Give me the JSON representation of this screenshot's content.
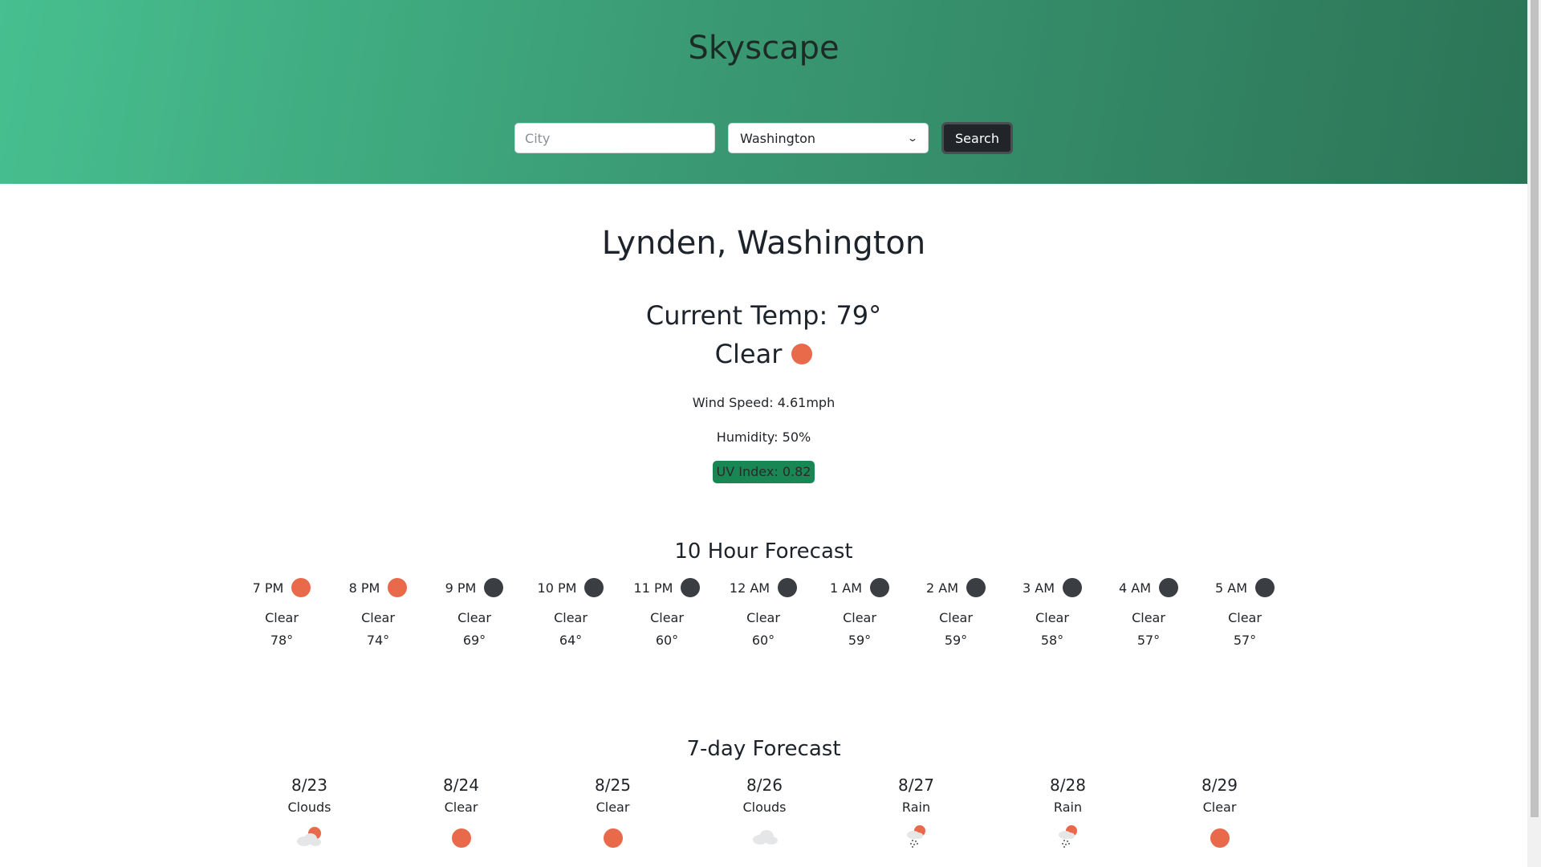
{
  "app": {
    "title": "Skyscape"
  },
  "search": {
    "city_placeholder": "City",
    "city_value": "",
    "state_selected": "Washington",
    "button_label": "Search"
  },
  "current": {
    "location": "Lynden, Washington",
    "temp": "Current Temp: 79°",
    "condition": "Clear",
    "condition_icon": "sun-icon",
    "wind": "Wind Speed: 4.61mph",
    "humidity": "Humidity: 50%",
    "uv": "UV Index: 0.82"
  },
  "hourly": {
    "title": "10 Hour Forecast",
    "items": [
      {
        "time": "7 PM",
        "icon": "sun-icon",
        "desc": "Clear",
        "temp": "78°"
      },
      {
        "time": "8 PM",
        "icon": "sun-icon",
        "desc": "Clear",
        "temp": "74°"
      },
      {
        "time": "9 PM",
        "icon": "moon-icon",
        "desc": "Clear",
        "temp": "69°"
      },
      {
        "time": "10 PM",
        "icon": "moon-icon",
        "desc": "Clear",
        "temp": "64°"
      },
      {
        "time": "11 PM",
        "icon": "moon-icon",
        "desc": "Clear",
        "temp": "60°"
      },
      {
        "time": "12 AM",
        "icon": "moon-icon",
        "desc": "Clear",
        "temp": "60°"
      },
      {
        "time": "1 AM",
        "icon": "moon-icon",
        "desc": "Clear",
        "temp": "59°"
      },
      {
        "time": "2 AM",
        "icon": "moon-icon",
        "desc": "Clear",
        "temp": "59°"
      },
      {
        "time": "3 AM",
        "icon": "moon-icon",
        "desc": "Clear",
        "temp": "58°"
      },
      {
        "time": "4 AM",
        "icon": "moon-icon",
        "desc": "Clear",
        "temp": "57°"
      },
      {
        "time": "5 AM",
        "icon": "moon-icon",
        "desc": "Clear",
        "temp": "57°"
      }
    ]
  },
  "daily": {
    "title": "7-day Forecast",
    "items": [
      {
        "date": "8/23",
        "desc": "Clouds",
        "icon": "sun-cloud-icon"
      },
      {
        "date": "8/24",
        "desc": "Clear",
        "icon": "sun-icon"
      },
      {
        "date": "8/25",
        "desc": "Clear",
        "icon": "sun-icon"
      },
      {
        "date": "8/26",
        "desc": "Clouds",
        "icon": "cloud-icon"
      },
      {
        "date": "8/27",
        "desc": "Rain",
        "icon": "rain-icon"
      },
      {
        "date": "8/28",
        "desc": "Rain",
        "icon": "rain-icon"
      },
      {
        "date": "8/29",
        "desc": "Clear",
        "icon": "sun-icon"
      }
    ]
  },
  "colors": {
    "header_start": "#47bf8f",
    "header_end": "#2c7457",
    "sun": "#e9694b",
    "moon": "#3a3d42",
    "uv_badge": "#198754",
    "button": "#212529"
  }
}
